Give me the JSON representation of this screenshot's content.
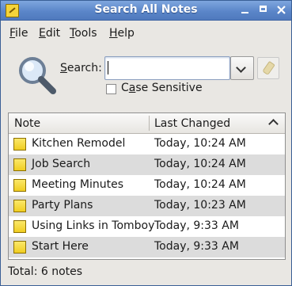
{
  "window": {
    "title": "Search All Notes"
  },
  "menubar": {
    "items": [
      {
        "accel": "F",
        "rest": "ile"
      },
      {
        "accel": "E",
        "rest": "dit"
      },
      {
        "accel": "T",
        "rest": "ools"
      },
      {
        "accel": "H",
        "rest": "elp"
      }
    ]
  },
  "search": {
    "label_accel": "S",
    "label_rest": "earch:",
    "value": "",
    "case_label_pre": "C",
    "case_label_accel": "a",
    "case_label_rest": "se Sensitive",
    "case_checked": false
  },
  "list": {
    "col_note": "Note",
    "col_changed": "Last Changed",
    "sort": "descending",
    "rows": [
      {
        "title": "Kitchen Remodel",
        "changed": "Today, 10:24 AM"
      },
      {
        "title": "Job Search",
        "changed": "Today, 10:24 AM"
      },
      {
        "title": "Meeting Minutes",
        "changed": "Today, 10:24 AM"
      },
      {
        "title": "Party Plans",
        "changed": "Today, 10:23 AM"
      },
      {
        "title": "Using Links in Tomboy",
        "changed": "Today, 9:33 AM"
      },
      {
        "title": "Start Here",
        "changed": "Today, 9:33 AM"
      }
    ]
  },
  "status": {
    "text": "Total: 6 notes"
  },
  "icons": {
    "app": "tomboy-note-icon",
    "search": "magnifier-icon",
    "dropdown": "chevron-down-icon",
    "clear": "eraser-icon",
    "note": "note-icon"
  },
  "colors": {
    "titlebar": "#5b86c9",
    "alt_row": "#dcdcdc",
    "note_yellow": "#f4d43a"
  }
}
